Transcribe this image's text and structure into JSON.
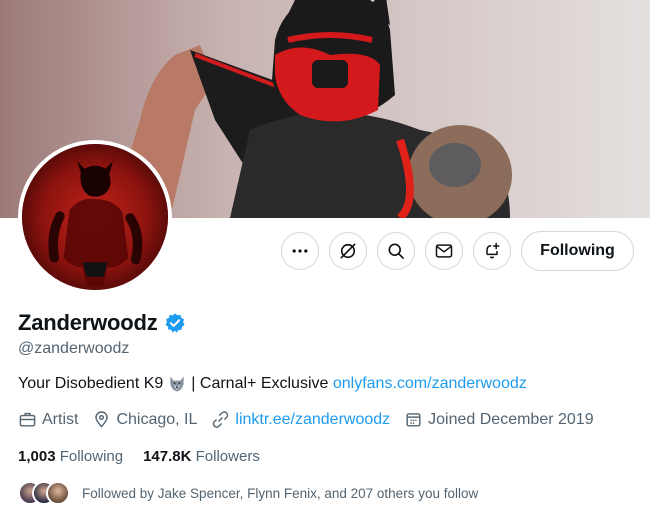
{
  "profile": {
    "display_name": "Zanderwoodz",
    "handle": "@zanderwoodz",
    "bio_text": "Your Disobedient K9",
    "bio_emoji": "wolf-emoji",
    "bio_after_emoji": "| Carnal+ Exclusive",
    "bio_link": "onlyfans.com/zanderwoodz",
    "category": "Artist",
    "location": "Chicago, IL",
    "website": "linktr.ee/zanderwoodz",
    "joined": "Joined December 2019"
  },
  "stats": {
    "following_count": "1,003",
    "following_label": "Following",
    "followers_count": "147.8K",
    "followers_label": "Followers"
  },
  "followed_by": "Followed by Jake Spencer, Flynn Fenix, and 207 others you follow",
  "actions": {
    "more_icon": "more-icon",
    "grok_icon": "grok-icon",
    "search_icon": "search-icon",
    "message_icon": "message-icon",
    "notify_icon": "notification-bell-icon",
    "follow_label": "Following"
  },
  "colors": {
    "link": "#1d9bf0",
    "secondary_text": "#536471",
    "primary_text": "#0f1419",
    "border": "#cfd9de",
    "verified": "#1d9bf0"
  }
}
